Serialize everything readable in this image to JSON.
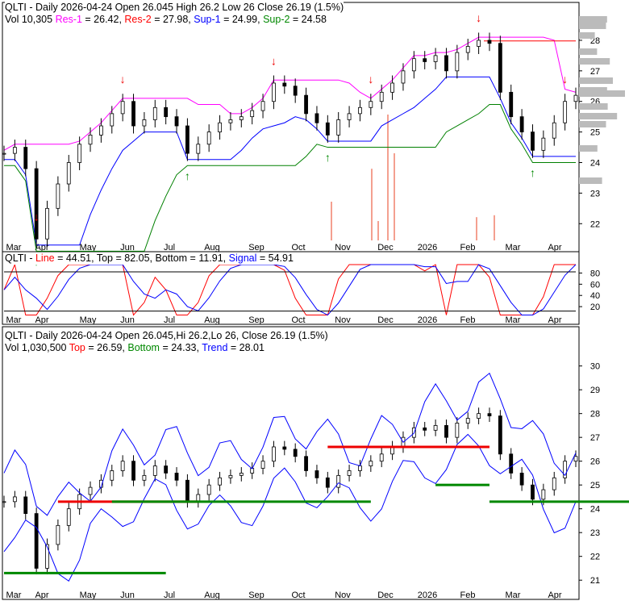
{
  "panel1": {
    "ticker": "QLTI - Daily 2026-04-24 Open 26.045  High 26.2  Low 26  Close 26.19 (1.5%)",
    "vol": "Vol 10,305",
    "res1_label": "Res-1",
    "res1": " = 26.42, ",
    "res2_label": "Res-2",
    "res2": " = 27.98, ",
    "sup1_label": "Sup-1",
    "sup1": " = 24.99, ",
    "sup2_label": "Sup-2",
    "sup2": " = 24.58"
  },
  "panel2": {
    "ticker": "QLTI - ",
    "line_label": "Line",
    "line": " = 44.51, Top = 82.05, Bottom = 11.91, ",
    "signal_label": "Signal",
    "signal": " = 54.91"
  },
  "panel3": {
    "ticker": "QLTI - Daily 2026-04-24 Open 26.045,Hi 26.2,Lo 26, Close 26.19 (1.5%)",
    "vol": "Vol 1,030,500 ",
    "top_label": "Top",
    "top": " = 26.59, ",
    "bottom_label": "Bottom",
    "bottom": " = 24.33, ",
    "trend_label": "Trend",
    "trend": " = 28.01"
  },
  "colors": {
    "up": "#000000",
    "res1": "#ff00ff",
    "res2": "#ff0000",
    "sup1": "#0000ff",
    "sup2": "#008000",
    "volume": "#f4a090"
  },
  "chart_data": [
    {
      "type": "line",
      "title": "QLTI Daily price",
      "months": [
        "Mar",
        "Apr",
        "May",
        "Jun",
        "Jul",
        "Aug",
        "Sep",
        "Oct",
        "Nov",
        "Dec",
        "2026",
        "Feb",
        "Mar",
        "Apr"
      ],
      "yticks": [
        22,
        23,
        24,
        25,
        26,
        27,
        28
      ],
      "ylim": [
        21.4,
        28.5
      ],
      "weekly_close": [
        24.3,
        24.5,
        23.8,
        21.5,
        22.5,
        23.3,
        24.0,
        24.6,
        24.9,
        25.2,
        25.6,
        26.0,
        25.2,
        25.4,
        25.8,
        25.5,
        25.2,
        24.3,
        24.6,
        25.0,
        25.3,
        25.4,
        25.5,
        25.7,
        26.0,
        26.6,
        26.5,
        26.2,
        25.6,
        25.3,
        24.9,
        25.4,
        25.6,
        25.8,
        26.0,
        26.3,
        26.6,
        27.0,
        27.4,
        27.3,
        27.5,
        27.0,
        27.6,
        27.8,
        28.0,
        27.9,
        26.3,
        25.5,
        25.0,
        24.4,
        24.8,
        25.3,
        26.0,
        26.2
      ]
    },
    {
      "type": "line",
      "title": "Stochastic",
      "yticks": [
        20,
        40,
        60,
        80
      ],
      "ylim": [
        0,
        95
      ],
      "series": [
        {
          "name": "Line",
          "last": 44.51
        },
        {
          "name": "Signal",
          "last": 54.91
        }
      ]
    },
    {
      "type": "line",
      "title": "Trend channel",
      "yticks": [
        21,
        22,
        23,
        24,
        25,
        26,
        27,
        28,
        29,
        30
      ],
      "ylim": [
        20.6,
        30.7
      ]
    }
  ]
}
